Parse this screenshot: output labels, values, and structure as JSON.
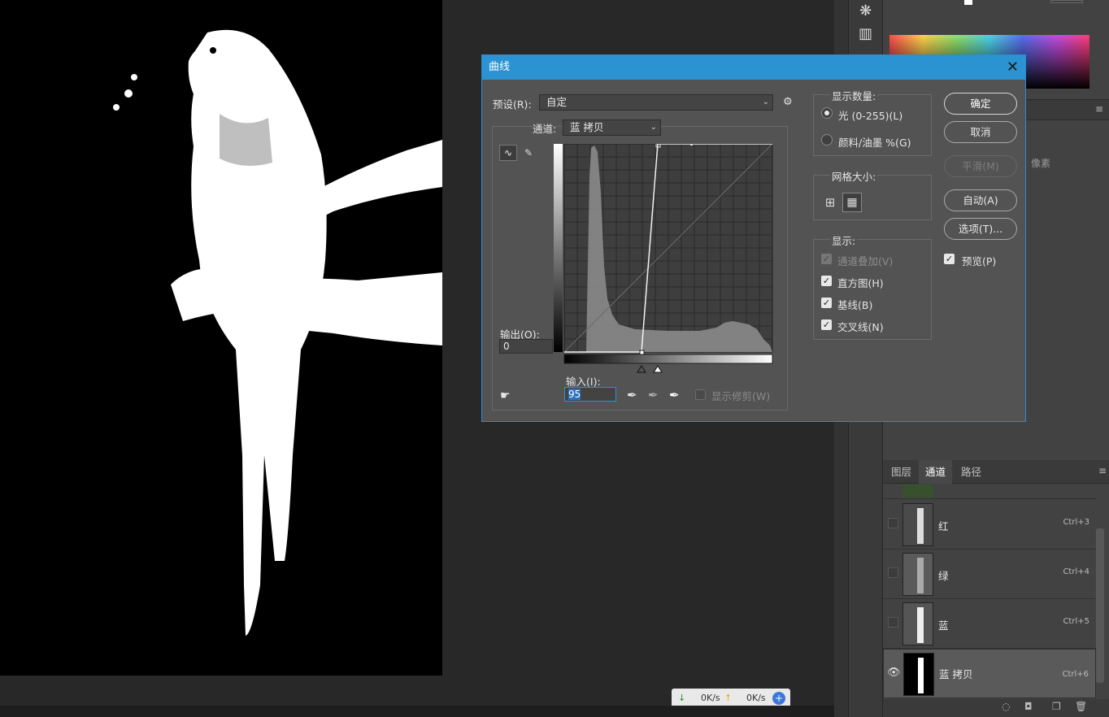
{
  "dialog": {
    "title": "曲线",
    "preset_label": "预设(R):",
    "preset_value": "自定",
    "channel_label": "通道:",
    "channel_value": "蓝 拷贝",
    "output_label": "输出(O):",
    "output_value": "0",
    "input_label": "输入(I):",
    "input_value": "95",
    "show_clipping": "显示修剪(W)",
    "display_amount": {
      "title": "显示数量:",
      "option_light": "光 (0-255)(L)",
      "option_pigment": "颜料/油墨 %(G)",
      "selected": "light"
    },
    "grid_size": {
      "title": "网格大小:"
    },
    "show": {
      "title": "显示:",
      "channel_overlay": "通道叠加(V)",
      "histogram": "直方图(H)",
      "baseline": "基线(B)",
      "intersection": "交叉线(N)"
    },
    "buttons": {
      "ok": "确定",
      "cancel": "取消",
      "smooth": "平滑(M)",
      "auto": "自动(A)",
      "options": "选项(T)...",
      "preview": "预览(P)"
    },
    "curve_points": [
      [
        0,
        0
      ],
      [
        95,
        0
      ],
      [
        135,
        255
      ],
      [
        255,
        255
      ]
    ]
  },
  "properties_fragment": "像素",
  "panel": {
    "tabs": [
      "图层",
      "通道",
      "路径"
    ],
    "active_tab": "通道",
    "channels": [
      {
        "name": "红",
        "shortcut": "Ctrl+3"
      },
      {
        "name": "绿",
        "shortcut": "Ctrl+4"
      },
      {
        "name": "蓝",
        "shortcut": "Ctrl+5"
      },
      {
        "name": "蓝 拷贝",
        "shortcut": "Ctrl+6"
      }
    ]
  },
  "netspeed": {
    "down": "0K/s",
    "up": "0K/s"
  },
  "colors": {
    "accent": "#2b93d2",
    "dialog_bg": "#535353"
  }
}
